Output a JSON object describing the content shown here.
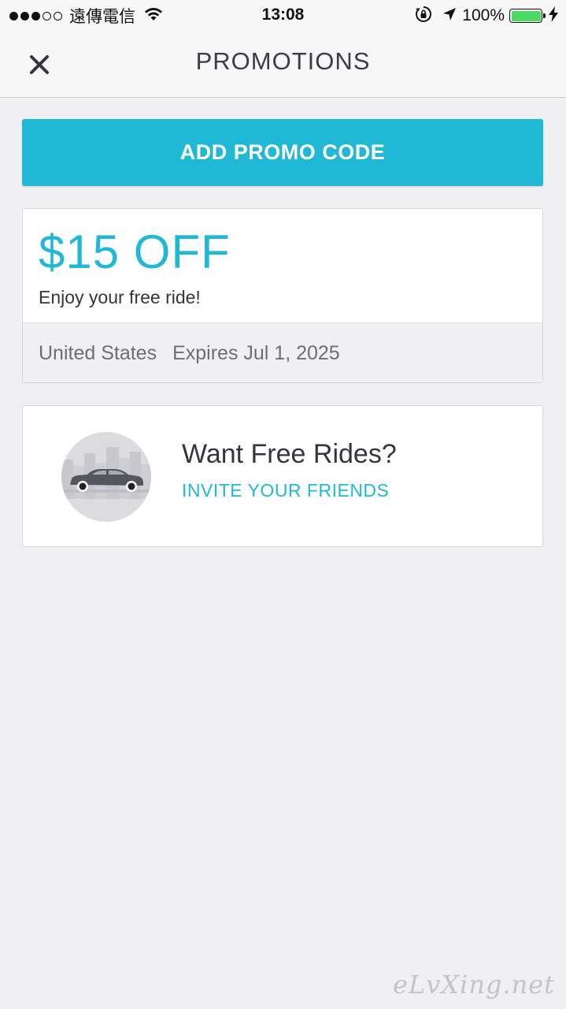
{
  "status_bar": {
    "signal_dots": [
      "full",
      "full",
      "full",
      "empty",
      "empty"
    ],
    "carrier": "遠傳電信",
    "time": "13:08",
    "battery_percent": "100%",
    "battery_level": 1.0,
    "icons": [
      "wifi-icon",
      "rotation-lock-icon",
      "location-arrow-icon",
      "battery-icon",
      "charging-bolt-icon"
    ]
  },
  "navbar": {
    "title": "PROMOTIONS",
    "close_icon": "close-icon"
  },
  "actions": {
    "add_promo_label": "ADD PROMO CODE"
  },
  "promo": {
    "amount": "$15 OFF",
    "description": "Enjoy your free ride!",
    "region": "United States",
    "expiry": "Expires Jul 1, 2025"
  },
  "invite": {
    "title": "Want Free Rides?",
    "link": "INVITE YOUR FRIENDS",
    "illustration": "car-city-illustration"
  },
  "colors": {
    "accent": "#21b8d6",
    "background": "#f0f0f3",
    "text_dark": "#333640",
    "battery_green": "#4cd964"
  },
  "watermark": "eLvXing.net"
}
